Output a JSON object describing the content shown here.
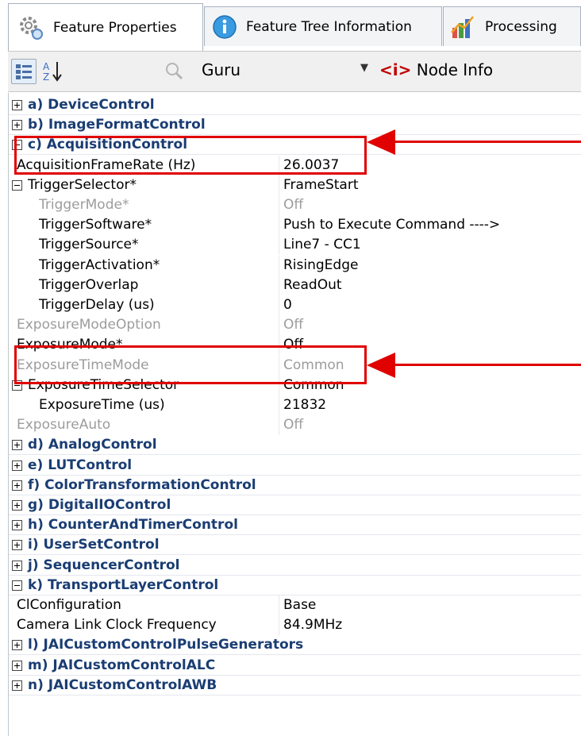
{
  "tabs": [
    {
      "label": "Feature Properties",
      "icon": "gear-icon",
      "active": true
    },
    {
      "label": "Feature Tree Information",
      "icon": "info-icon",
      "active": false
    },
    {
      "label": "Processing",
      "icon": "chart-icon",
      "active": false
    }
  ],
  "toolbar": {
    "categorized_icon": "categorized-view-icon",
    "sort_icon": "sort-az-icon",
    "search_icon": "search-icon",
    "visibility": "Guru",
    "node_info_tag": "<i>",
    "node_info_label": "Node Info"
  },
  "rows": [
    {
      "type": "category",
      "name": "a) DeviceControl",
      "expander": "plus"
    },
    {
      "type": "category",
      "name": "b) ImageFormatControl",
      "expander": "plus"
    },
    {
      "type": "category",
      "name": "c) AcquisitionControl",
      "expander": "minus"
    },
    {
      "type": "property",
      "name": "AcquisitionFrameRate (Hz)",
      "value": "26.0037",
      "indent": 0
    },
    {
      "type": "property",
      "name": "TriggerSelector*",
      "value": "FrameStart",
      "expander": "minus",
      "indent": 0
    },
    {
      "type": "property",
      "name": "TriggerMode*",
      "value": "Off",
      "indent": 1,
      "dim": true
    },
    {
      "type": "property",
      "name": "TriggerSoftware*",
      "value": "Push to Execute Command ---->",
      "indent": 1
    },
    {
      "type": "property",
      "name": "TriggerSource*",
      "value": "Line7 - CC1",
      "indent": 1
    },
    {
      "type": "property",
      "name": "TriggerActivation*",
      "value": "RisingEdge",
      "indent": 1
    },
    {
      "type": "property",
      "name": "TriggerOverlap",
      "value": "ReadOut",
      "indent": 1
    },
    {
      "type": "property",
      "name": "TriggerDelay (us)",
      "value": "0",
      "indent": 1
    },
    {
      "type": "property",
      "name": "ExposureModeOption",
      "value": "Off",
      "indent": 0,
      "dim": true
    },
    {
      "type": "property",
      "name": "ExposureMode*",
      "value": "Off",
      "indent": 0
    },
    {
      "type": "property",
      "name": "ExposureTimeMode",
      "value": "Common",
      "indent": 0,
      "dim": true
    },
    {
      "type": "property",
      "name": "ExposureTimeSelector",
      "value": "Common",
      "expander": "minus",
      "indent": 0
    },
    {
      "type": "property",
      "name": "ExposureTime (us)",
      "value": "21832",
      "indent": 1
    },
    {
      "type": "property",
      "name": "ExposureAuto",
      "value": "Off",
      "indent": 0,
      "dim": true
    },
    {
      "type": "category",
      "name": "d) AnalogControl",
      "expander": "plus"
    },
    {
      "type": "category",
      "name": "e) LUTControl",
      "expander": "plus"
    },
    {
      "type": "category",
      "name": "f) ColorTransformationControl",
      "expander": "plus"
    },
    {
      "type": "category",
      "name": "g) DigitalIOControl",
      "expander": "plus"
    },
    {
      "type": "category",
      "name": "h) CounterAndTimerControl",
      "expander": "plus"
    },
    {
      "type": "category",
      "name": "i) UserSetControl",
      "expander": "plus"
    },
    {
      "type": "category",
      "name": "j) SequencerControl",
      "expander": "plus"
    },
    {
      "type": "category",
      "name": "k) TransportLayerControl",
      "expander": "minus"
    },
    {
      "type": "property",
      "name": "ClConfiguration",
      "value": "Base",
      "indent": 0
    },
    {
      "type": "property",
      "name": "Camera Link Clock Frequency",
      "value": "84.9MHz",
      "indent": 0
    },
    {
      "type": "category",
      "name": "l) JAICustomControlPulseGenerators",
      "expander": "plus"
    },
    {
      "type": "category",
      "name": "m) JAICustomControlALC",
      "expander": "plus"
    },
    {
      "type": "category",
      "name": "n) JAICustomControlAWB",
      "expander": "plus"
    }
  ],
  "colors": {
    "highlight": "#e00000",
    "category_text": "#1a3d73"
  }
}
